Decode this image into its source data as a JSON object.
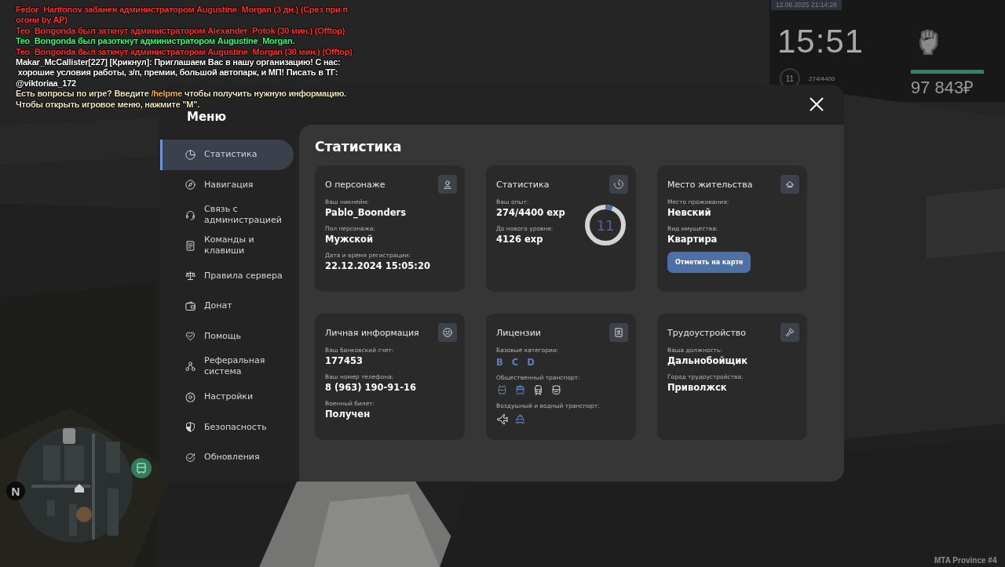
{
  "chat": [
    {
      "parts": [
        {
          "text": "Fedor_Haritonov забанен администратором Augustine_Morgan (3 дн.) (Срез при п",
          "color": "#ff2b2b"
        }
      ]
    },
    {
      "parts": [
        {
          "text": "огони by AP)",
          "color": "#ff2b2b"
        }
      ]
    },
    {
      "parts": [
        {
          "text": "Teo_Bongonda был заткнут администратором Alexander_Potok (30 мин.) (Offtop)",
          "color": "#ff2b2b"
        }
      ]
    },
    {
      "parts": [
        {
          "text": "Teo_Bongonda был разоткнут администратором Augustine_Morgan.",
          "color": "#2bff6e"
        }
      ]
    },
    {
      "parts": [
        {
          "text": "Teo_Bongonda был заткнут администратором Augustine_Morgan (30 мин.) (Offtop)",
          "color": "#ff2b2b"
        }
      ]
    },
    {
      "parts": [
        {
          "text": "Makar_McCallister[227] [Крикнул]: Приглашаем Вас в нашу организацию! С нас:",
          "color": "#ffffff"
        }
      ]
    },
    {
      "parts": [
        {
          "text": " хорошие условия работы, з/п, премии, большой автопарк, и МП! Писать в ТГ:",
          "color": "#ffffff"
        }
      ]
    },
    {
      "parts": [
        {
          "text": "@viktoriaa_172",
          "color": "#ffffff"
        }
      ]
    },
    {
      "parts": [
        {
          "text": "Есть вопросы по игре? Введите ",
          "color": "#f2e6b8"
        },
        {
          "text": "/helpme",
          "color": "#ffb020"
        },
        {
          "text": " чтобы получить нужную информацию.",
          "color": "#f2e6b8"
        }
      ]
    },
    {
      "parts": [
        {
          "text": "Чтобы открыть игровое меню, нажмите \"M\".",
          "color": "#f2e6b8"
        }
      ]
    }
  ],
  "hud": {
    "datetime": "12.06.2025 21:14:26",
    "clock": "15:51",
    "level": "11",
    "exp": "274/4400",
    "health": {
      "level": 1
    },
    "money": "97 843₽",
    "server": "MTA Province #4",
    "minimap": {
      "north": "N"
    }
  },
  "menu": {
    "title": "Меню",
    "sidebar": [
      {
        "label": "Статистика",
        "selected": true
      },
      {
        "label": "Навигация",
        "selected": false
      },
      {
        "label": "Связь с администрацией",
        "selected": false
      },
      {
        "label": "Команды и клавиши",
        "selected": false
      },
      {
        "label": "Правила сервера",
        "selected": false
      },
      {
        "label": "Донат",
        "selected": false
      },
      {
        "label": "Помощь",
        "selected": false
      },
      {
        "label": "Реферальная система",
        "selected": false
      },
      {
        "label": "Настройки",
        "selected": false
      },
      {
        "label": "Безопасность",
        "selected": false
      },
      {
        "label": "Обновления",
        "selected": false
      }
    ],
    "section_title": "Статистика",
    "cards": [
      {
        "kind": "info",
        "title": "О персонаже",
        "fields": [
          {
            "label": "Ваш никнейм:",
            "value": "Pablo_Boonders"
          },
          {
            "label": "Пол персонажа:",
            "value": "Мужской"
          },
          {
            "label": "Дата и время регистрации:",
            "value": "22.12.2024 15:05:20"
          }
        ]
      },
      {
        "kind": "progress",
        "title": "Статистика",
        "fields": [
          {
            "label": "Ваш опыт:",
            "value": "274/4400 exp"
          },
          {
            "label": "До нового уровня:",
            "value": "4126 exp"
          }
        ],
        "ring": {
          "value": "11",
          "level": 0.062
        }
      },
      {
        "kind": "info",
        "title": "Место жительства",
        "fields": [
          {
            "label": "Место проживания:",
            "value": "Невский"
          },
          {
            "label": "Вид имущества:",
            "value": "Квартира"
          }
        ],
        "button": "Отметить на карте"
      },
      {
        "kind": "info",
        "title": "Личная информация",
        "fields": [
          {
            "label": "Ваш банковский счет:",
            "value": "177453"
          },
          {
            "label": "Ваш номер телефона:",
            "value": "8 (963) 190-91-16"
          },
          {
            "label": "Военный билет:",
            "value": "Получен"
          }
        ]
      },
      {
        "kind": "licenses",
        "title": "Лицензии",
        "groups": [
          {
            "label": "Базовые категории:",
            "kind": "letters",
            "items": [
              {
                "text": "B",
                "owned": true
              },
              {
                "text": "C",
                "owned": true
              },
              {
                "text": "D",
                "owned": true
              }
            ]
          },
          {
            "label": "Общественный транспорт:",
            "kind": "icons",
            "items": [
              {
                "owned": true
              },
              {
                "owned": true
              },
              {
                "owned": false
              },
              {
                "owned": false
              }
            ]
          },
          {
            "label": "Воздушный и водный транспорт:",
            "kind": "icons",
            "items": [
              {
                "owned": false
              },
              {
                "owned": true
              }
            ]
          }
        ]
      },
      {
        "kind": "info",
        "title": "Трудоустройство",
        "fields": [
          {
            "label": "Ваша должность:",
            "value": "Дальнобойщик"
          },
          {
            "label": "Город трудоустройства:",
            "value": "Приволжск"
          }
        ]
      }
    ]
  }
}
